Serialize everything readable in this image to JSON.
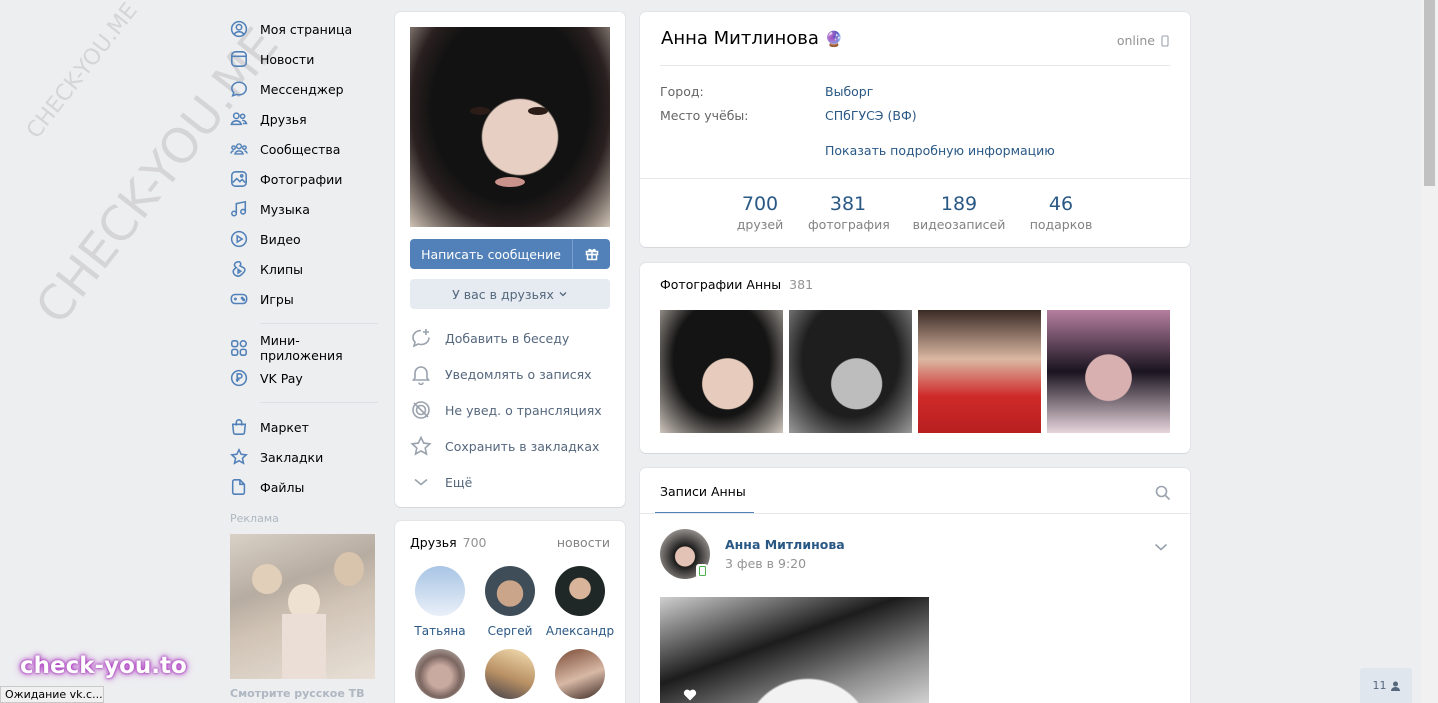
{
  "watermark": {
    "large": "CHECK-YOU.ME",
    "small": "CHECK-YOU.ME",
    "brand": "check-you.to"
  },
  "status_bar": "Ожидание vk.c...",
  "notif_count": "11",
  "nav": {
    "items": [
      {
        "label": "Моя страница",
        "icon": "user-circle-icon"
      },
      {
        "label": "Новости",
        "icon": "news-icon"
      },
      {
        "label": "Мессенджер",
        "icon": "message-icon"
      },
      {
        "label": "Друзья",
        "icon": "friends-icon"
      },
      {
        "label": "Сообщества",
        "icon": "groups-icon"
      },
      {
        "label": "Фотографии",
        "icon": "photo-icon"
      },
      {
        "label": "Музыка",
        "icon": "music-icon"
      },
      {
        "label": "Видео",
        "icon": "video-icon"
      },
      {
        "label": "Клипы",
        "icon": "clips-icon"
      },
      {
        "label": "Игры",
        "icon": "gamepad-icon"
      }
    ],
    "items2": [
      {
        "label": "Мини-приложения",
        "icon": "apps-icon"
      },
      {
        "label": "VK Pay",
        "icon": "vkpay-icon"
      }
    ],
    "items3": [
      {
        "label": "Маркет",
        "icon": "market-icon"
      },
      {
        "label": "Закладки",
        "icon": "star-icon"
      },
      {
        "label": "Файлы",
        "icon": "file-icon"
      }
    ],
    "ad_title": "Реклама",
    "ad_caption": "Смотрите русское ТВ"
  },
  "profile_actions": {
    "write_message": "Написать сообщение",
    "friend_status": "У вас в друзьях",
    "actions": [
      {
        "label": "Добавить в беседу",
        "icon": "add-chat-icon"
      },
      {
        "label": "Уведомлять о записях",
        "icon": "bell-icon"
      },
      {
        "label": "Не увед. о трансляциях",
        "icon": "broadcast-off-icon"
      },
      {
        "label": "Сохранить в закладках",
        "icon": "star-icon"
      },
      {
        "label": "Ещё",
        "icon": "chevron-down-icon"
      }
    ]
  },
  "friends": {
    "title": "Друзья",
    "count": "700",
    "news_link": "новости",
    "list": [
      {
        "name": "Татьяна",
        "color": "#9bbce0"
      },
      {
        "name": "Сергей",
        "color": "#6e7f8e"
      },
      {
        "name": "Александр",
        "color": "#2f3a35"
      },
      {
        "name": "",
        "color": "#b9a7a2"
      },
      {
        "name": "",
        "color": "#c9a986"
      },
      {
        "name": "",
        "color": "#6b4b3e"
      }
    ]
  },
  "profile": {
    "name": "Анна Митлинова",
    "emoji": "🔮",
    "status": "online",
    "info": [
      {
        "key": "Город:",
        "value": "Выборг"
      },
      {
        "key": "Место учёбы:",
        "value": "СПбГУСЭ (ВФ)"
      }
    ],
    "more_info": "Показать подробную информацию",
    "counters": [
      {
        "num": "700",
        "label": "друзей"
      },
      {
        "num": "381",
        "label": "фотография"
      },
      {
        "num": "189",
        "label": "видеозаписей"
      },
      {
        "num": "46",
        "label": "подарков"
      }
    ]
  },
  "photos": {
    "title": "Фотографии Анны",
    "count": "381"
  },
  "wall": {
    "tab": "Записи Анны",
    "post_author": "Анна Митлинова",
    "post_date": "3 фев в 9:20"
  },
  "colors": {
    "accent": "#5181b8",
    "link": "#2a5885",
    "bg": "#edeef0"
  }
}
